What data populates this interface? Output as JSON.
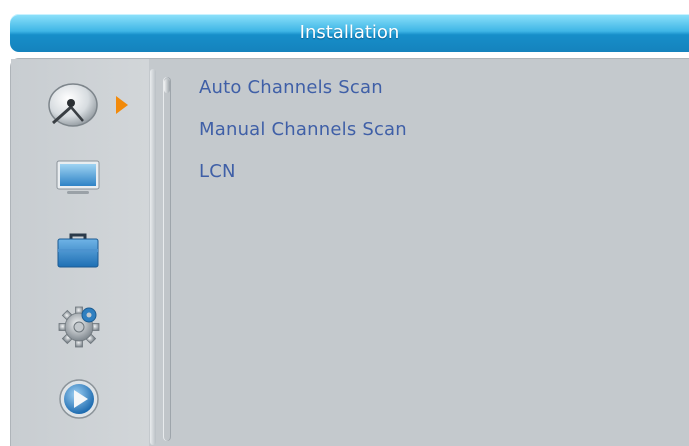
{
  "header": {
    "title": "Installation"
  },
  "sidebar": {
    "icons": [
      {
        "name": "satellite-dish-icon",
        "selected": true
      },
      {
        "name": "tv-icon"
      },
      {
        "name": "toolbox-icon"
      },
      {
        "name": "gear-icon"
      },
      {
        "name": "play-icon"
      }
    ]
  },
  "menu": {
    "items": [
      {
        "label": "Auto Channels Scan"
      },
      {
        "label": "Manual Channels Scan"
      },
      {
        "label": "LCN"
      }
    ]
  },
  "colors": {
    "title_bar": "#1583bd",
    "menu_text": "#3f5fa7",
    "selection_arrow": "#f28a0a",
    "panel_bg": "#c4c9cd"
  }
}
